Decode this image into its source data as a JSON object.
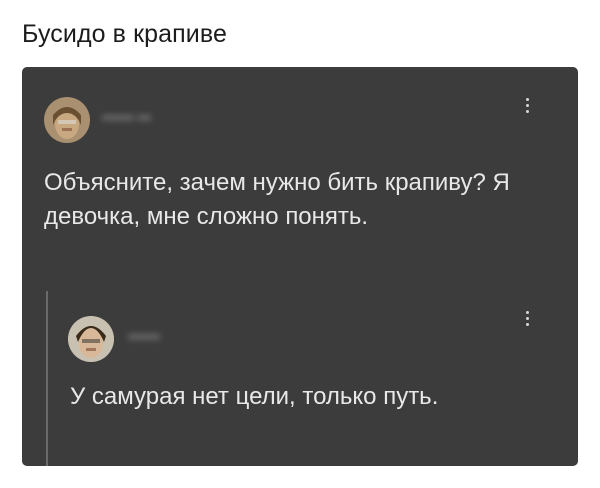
{
  "post": {
    "title": "Бусидо в крапиве"
  },
  "comment": {
    "username": "••••••• •••",
    "text": "Объясните, зачем нужно бить крапиву? Я девочка, мне сложно понять.",
    "menu_icon": "more-vertical-icon"
  },
  "reply": {
    "username": "•••••••",
    "text": "У самурая нет цели, только путь.",
    "menu_icon": "more-vertical-icon"
  },
  "colors": {
    "card_background": "#3c3c3c",
    "text": "#e8e8e8",
    "page_background": "#ffffff"
  }
}
